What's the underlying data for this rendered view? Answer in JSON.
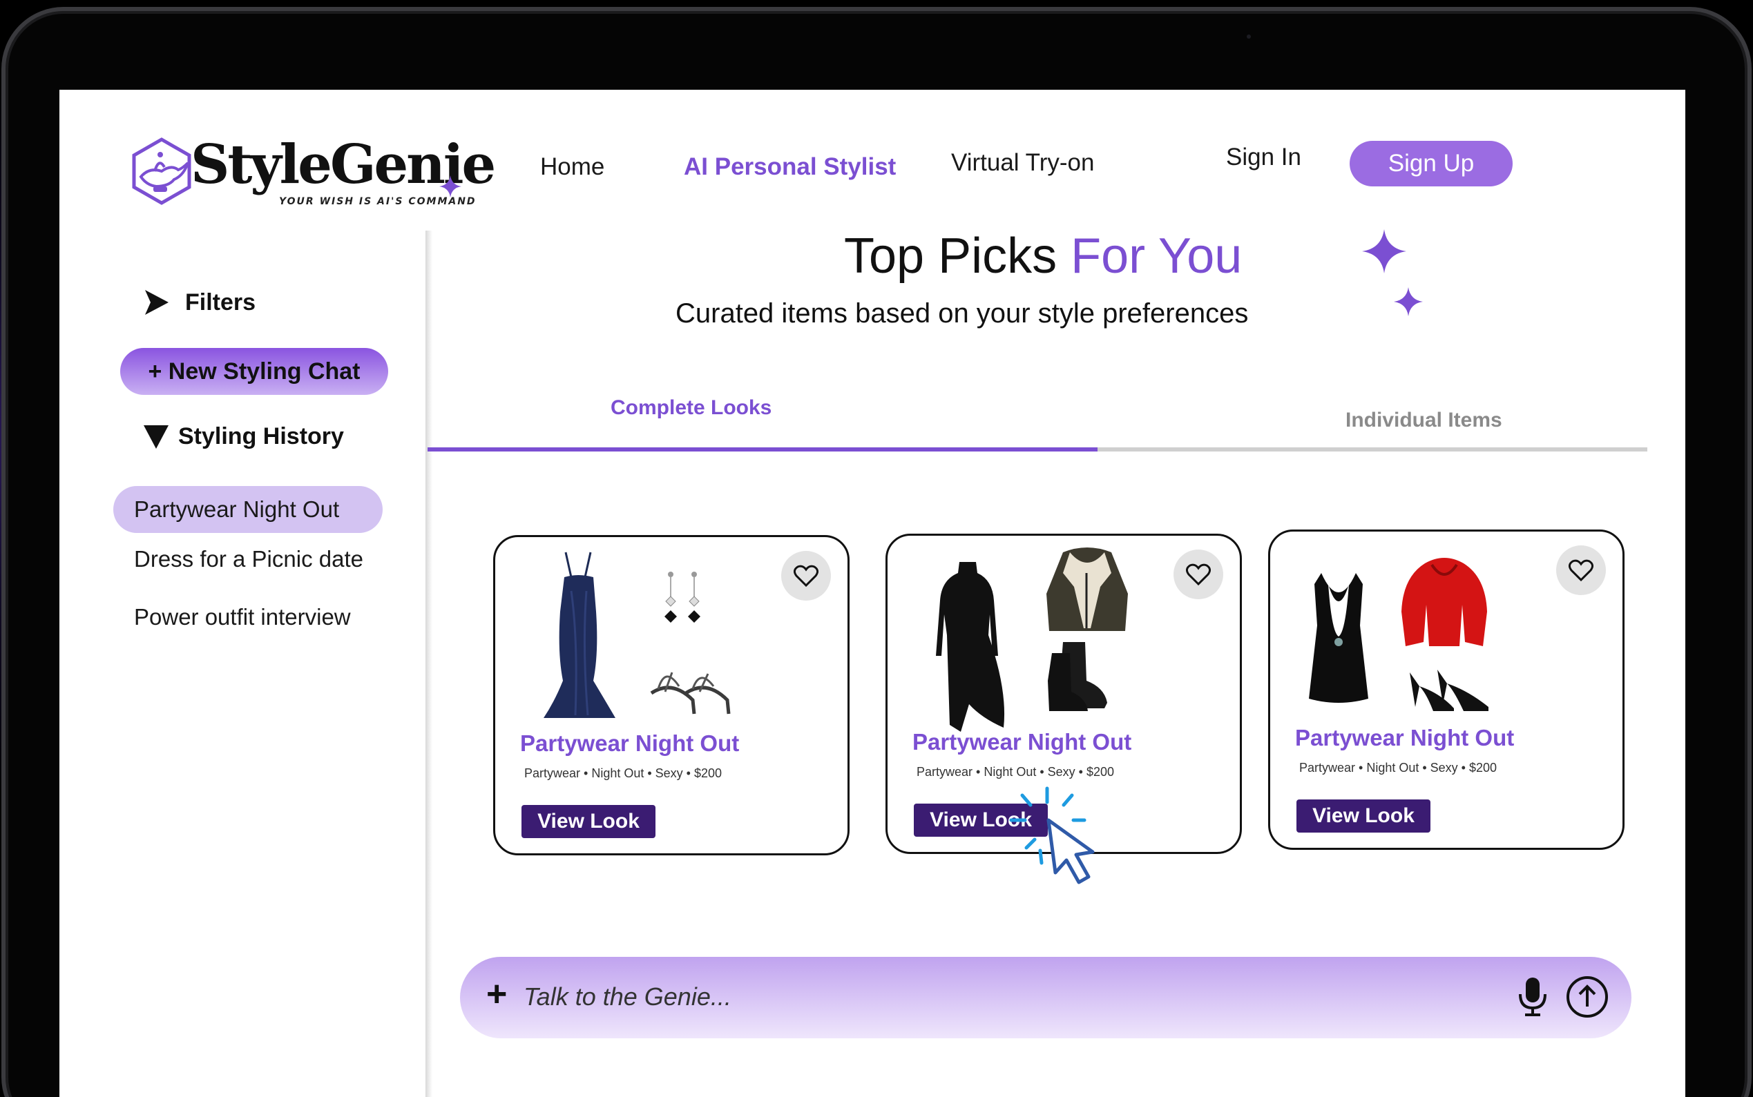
{
  "brand": {
    "name": "StyleGenie",
    "tagline": "YOUR WISH IS AI'S COMMAND",
    "accent_color": "#7b4fd2",
    "button_color": "#9b6ce2",
    "dark_button_color": "#3b1c72"
  },
  "nav": {
    "home": "Home",
    "ai_stylist": "AI Personal Stylist",
    "virtual_tryon": "Virtual Try-on",
    "sign_in": "Sign In",
    "sign_up": "Sign Up"
  },
  "sidebar": {
    "filters_label": "Filters",
    "new_chat_label": "+ New Styling Chat",
    "history_label": "Styling History",
    "history_items": [
      {
        "label": "Partywear Night Out",
        "active": true
      },
      {
        "label": "Dress for a Picnic date",
        "active": false
      },
      {
        "label": "Power outfit interview",
        "active": false
      }
    ]
  },
  "main": {
    "title_plain": "Top Picks ",
    "title_accent": "For You",
    "subtitle": "Curated items based on your style preferences",
    "tabs": [
      {
        "label": "Complete Looks",
        "active": true
      },
      {
        "label": "Individual Items",
        "active": false
      }
    ]
  },
  "cards": [
    {
      "title": "Partywear Night Out",
      "meta": "Partywear • Night Out • Sexy • $200",
      "button": "View Look",
      "items": [
        "navy-mermaid-gown",
        "black-drop-earrings",
        "strappy-heels"
      ]
    },
    {
      "title": "Partywear Night Out",
      "meta": "Partywear • Night Out • Sexy • $200",
      "button": "View Look",
      "items": [
        "black-asymmetric-dress",
        "shearling-aviator-jacket",
        "black-ankle-boots"
      ]
    },
    {
      "title": "Partywear Night Out",
      "meta": "Partywear • Night Out • Sexy • $200",
      "button": "View Look",
      "items": [
        "black-halter-cutout-dress",
        "red-fur-jacket",
        "black-pumps"
      ]
    }
  ],
  "chat": {
    "plus": "+",
    "placeholder": "Talk to the Genie..."
  }
}
